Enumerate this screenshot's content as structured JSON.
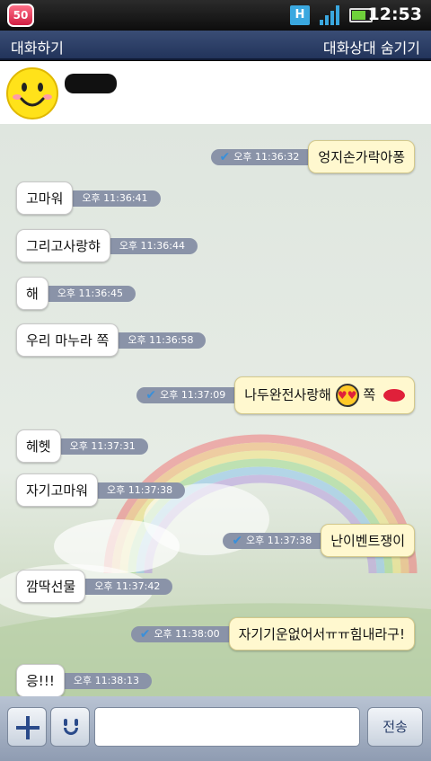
{
  "status_bar": {
    "app_badge": "50",
    "network": "H",
    "time": "12:53"
  },
  "header": {
    "left_title": "대화하기",
    "right_action": "대화상대 숨기기"
  },
  "input_bar": {
    "send_label": "전송"
  },
  "messages": [
    {
      "dir": "out",
      "text": "엉지손가락아퐁",
      "time": "오후 11:36:32"
    },
    {
      "dir": "in",
      "text": "고마워",
      "time": "오후 11:36:41"
    },
    {
      "dir": "in",
      "text": "그리고사랑햐",
      "time": "오후 11:36:44"
    },
    {
      "dir": "in",
      "text": "해",
      "time": "오후 11:36:45"
    },
    {
      "dir": "in",
      "text": "우리 마누라 쪽",
      "time": "오후 11:36:58"
    },
    {
      "dir": "out",
      "text": "나두완전사랑해",
      "text_after": "쪽",
      "time": "오후 11:37:09"
    },
    {
      "dir": "in",
      "text": "헤헷",
      "time": "오후 11:37:31"
    },
    {
      "dir": "in",
      "text": "자기고마워",
      "time": "오후 11:37:38"
    },
    {
      "dir": "out",
      "text": "난이벤트쟁이",
      "time": "오후 11:37:38"
    },
    {
      "dir": "in",
      "text": "깜딱선물",
      "time": "오후 11:37:42"
    },
    {
      "dir": "out",
      "text": "자기기운없어서ㅠㅠ힘내라구!",
      "time": "오후 11:38:00"
    },
    {
      "dir": "in",
      "text": "응!!!",
      "time": "오후 11:38:13"
    }
  ]
}
